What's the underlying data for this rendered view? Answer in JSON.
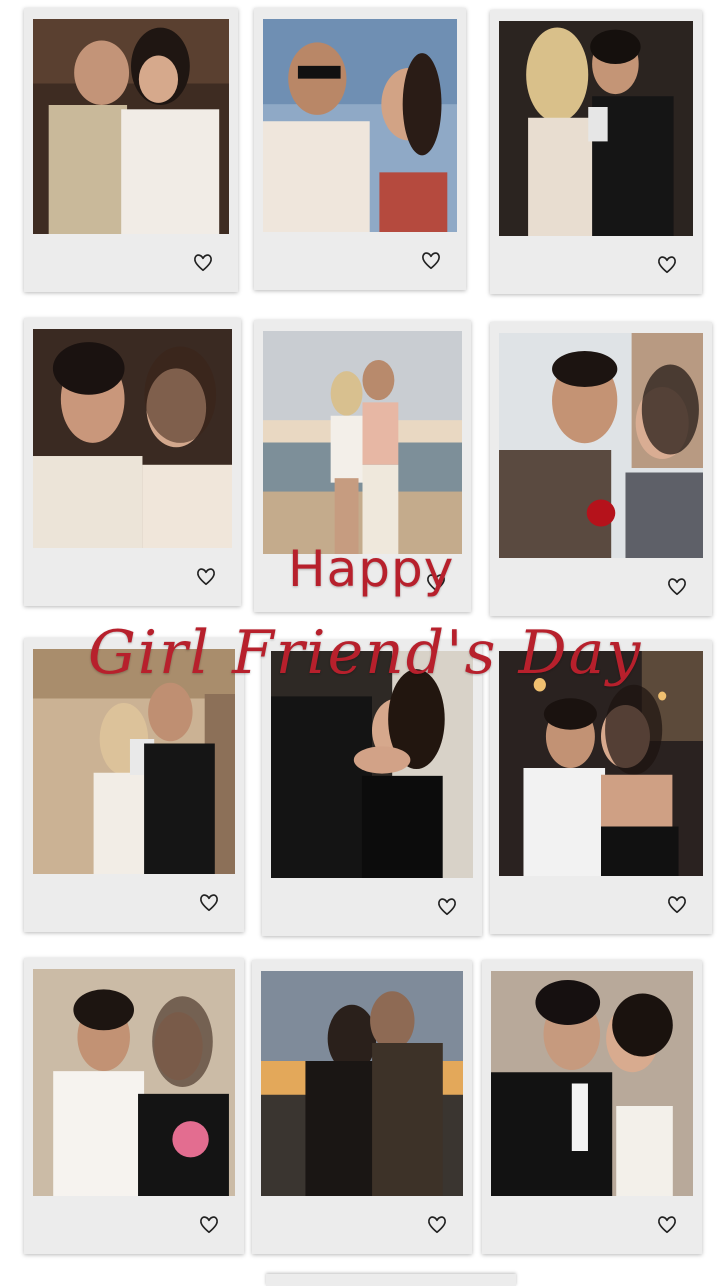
{
  "overlay": {
    "line1": "Happy",
    "line2": "Girl Friend's Day"
  },
  "colors": {
    "overlay_text": "#b7202c",
    "frame": "#ececec",
    "heart": "#222222"
  },
  "photos": [
    {
      "icon": "heart-icon",
      "scene": "warm-indoor"
    },
    {
      "icon": "heart-icon",
      "scene": "blue-sky"
    },
    {
      "icon": "heart-icon",
      "scene": "dark-room"
    },
    {
      "icon": "heart-icon",
      "scene": "warm-indoor"
    },
    {
      "icon": "heart-icon",
      "scene": "beach-sunset"
    },
    {
      "icon": "heart-icon",
      "scene": "daylight-street"
    },
    {
      "icon": "heart-icon",
      "scene": "mirror-room"
    },
    {
      "icon": "heart-icon",
      "scene": "dark-room"
    },
    {
      "icon": "heart-icon",
      "scene": "night-street"
    },
    {
      "icon": "heart-icon",
      "scene": "beige-wall"
    },
    {
      "icon": "heart-icon",
      "scene": "sunset-hills"
    },
    {
      "icon": "heart-icon",
      "scene": "beige-wall"
    }
  ]
}
